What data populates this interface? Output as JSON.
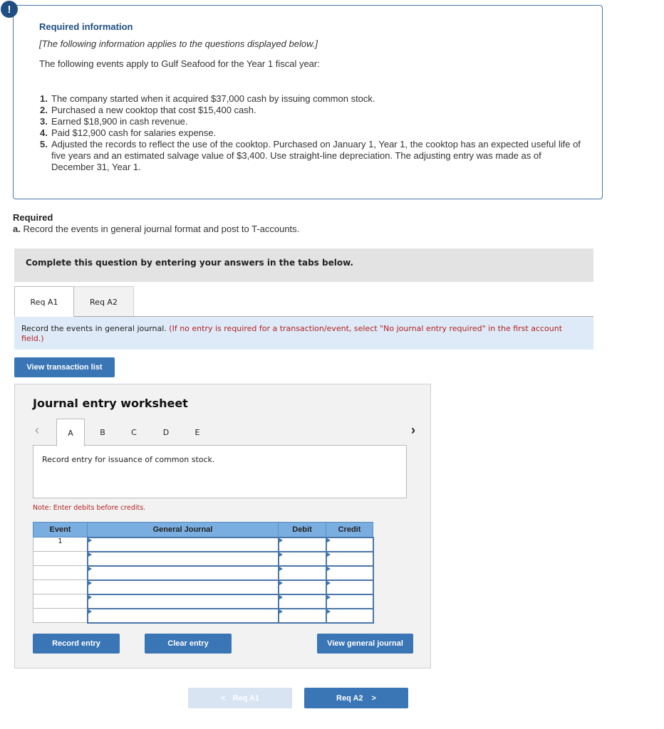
{
  "info": {
    "badge": "!",
    "title": "Required information",
    "subtitle": "[The following information applies to the questions displayed below.]",
    "intro": "The following events apply to Gulf Seafood for the Year 1 fiscal year:",
    "events": [
      {
        "num": "1.",
        "text": "The company started when it acquired $37,000 cash by issuing common stock."
      },
      {
        "num": "2.",
        "text": "Purchased a new cooktop that cost $15,400 cash."
      },
      {
        "num": "3.",
        "text": "Earned $18,900 in cash revenue."
      },
      {
        "num": "4.",
        "text": "Paid $12,900 cash for salaries expense."
      },
      {
        "num": "5.",
        "text": "Adjusted the records to reflect the use of the cooktop. Purchased on January 1, Year 1, the cooktop has an expected useful life of five years and an estimated salvage value of $3,400. Use straight-line depreciation. The adjusting entry was made as of December 31, Year 1."
      }
    ]
  },
  "required": {
    "heading": "Required",
    "part_label": "a.",
    "part_text": "Record the events in general journal format and post to T-accounts."
  },
  "complete_bar": "Complete this question by entering your answers in the tabs below.",
  "req_tabs": [
    {
      "label": "Req A1",
      "active": true
    },
    {
      "label": "Req A2",
      "active": false
    }
  ],
  "instruction": {
    "text": "Record the events in general journal.",
    "note": "(If no entry is required for a transaction/event, select \"No journal entry required\" in the first account field.)"
  },
  "view_transaction_list": "View transaction list",
  "worksheet": {
    "title": "Journal entry worksheet",
    "tabs": [
      "A",
      "B",
      "C",
      "D",
      "E"
    ],
    "active_tab": "A",
    "description": "Record entry for issuance of common stock.",
    "note": "Note: Enter debits before credits.",
    "columns": [
      "Event",
      "General Journal",
      "Debit",
      "Credit"
    ],
    "rows": [
      {
        "event": "1",
        "account": "",
        "debit": "",
        "credit": ""
      },
      {
        "event": "",
        "account": "",
        "debit": "",
        "credit": ""
      },
      {
        "event": "",
        "account": "",
        "debit": "",
        "credit": ""
      },
      {
        "event": "",
        "account": "",
        "debit": "",
        "credit": ""
      },
      {
        "event": "",
        "account": "",
        "debit": "",
        "credit": ""
      },
      {
        "event": "",
        "account": "",
        "debit": "",
        "credit": ""
      }
    ],
    "record_entry": "Record entry",
    "clear_entry": "Clear entry",
    "view_general_journal": "View general journal"
  },
  "nav": {
    "prev_label": "Req A1",
    "next_label": "Req A2",
    "prev_enabled": false
  },
  "colors": {
    "brand_blue": "#3a75b5",
    "header_blue": "#7aaee0",
    "note_red": "#b22222",
    "title_navy": "#1f4e82"
  }
}
